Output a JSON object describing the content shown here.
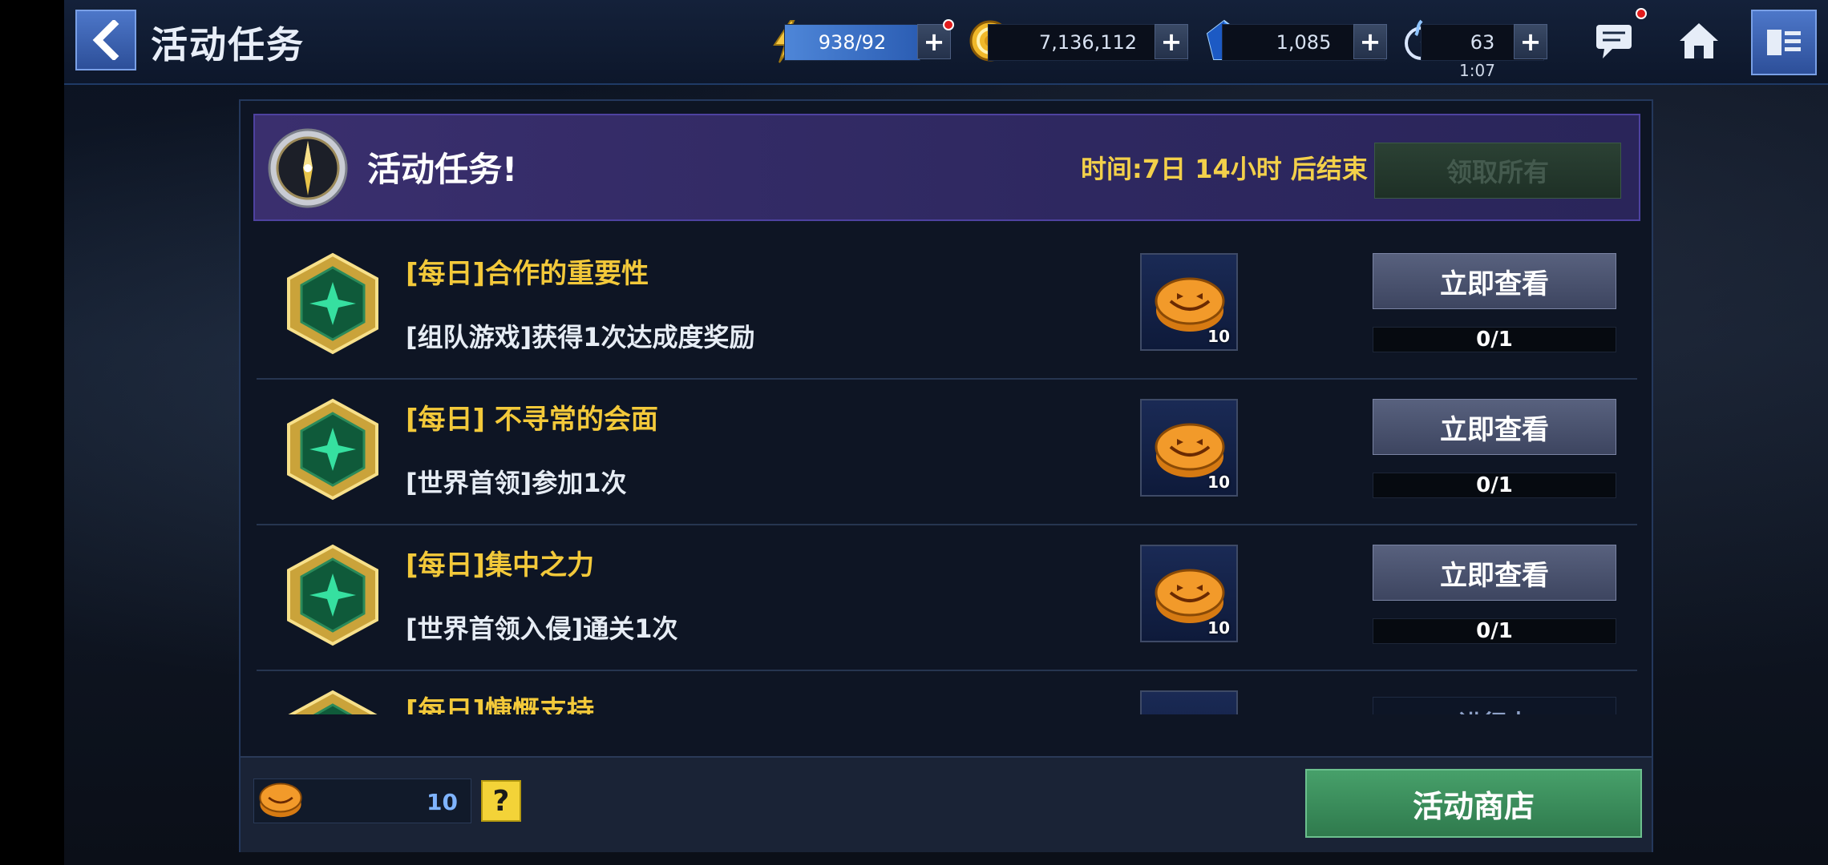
{
  "header": {
    "title": "活动任务",
    "energy": "938/92",
    "gold": "7,136,112",
    "crystal": "1,085",
    "stamina": "63",
    "stamina_timer": "1:07"
  },
  "panel": {
    "title": "活动任务!",
    "timer": "时间:7日 14小时 后结束",
    "claim_all_label": "领取所有"
  },
  "tasks": [
    {
      "name": "[每日]合作的重要性",
      "desc": "[组队游戏]获得1次达成度奖励",
      "reward_qty": "10",
      "button": "立即查看",
      "progress": "0/1"
    },
    {
      "name": "[每日] 不寻常的会面",
      "desc": "[世界首领]参加1次",
      "reward_qty": "10",
      "button": "立即查看",
      "progress": "0/1"
    },
    {
      "name": "[每日]集中之力",
      "desc": "[世界首领入侵]通关1次",
      "reward_qty": "10",
      "button": "立即查看",
      "progress": "0/1"
    },
    {
      "name": "[每日]慷慨支持",
      "desc": "",
      "reward_qty": "",
      "status": "进行中"
    }
  ],
  "footer": {
    "currency_amount": "10",
    "help_label": "?",
    "shop_label": "活动商店"
  },
  "colors": {
    "accent_gold": "#f3c93a",
    "shop_green": "#47a06a",
    "header_purple": "#3a2f6e"
  }
}
